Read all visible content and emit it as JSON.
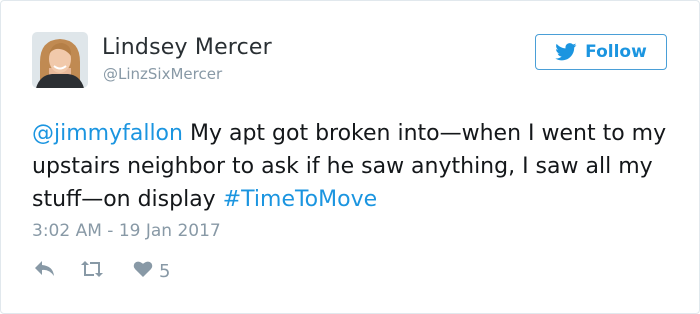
{
  "tweet": {
    "author_name": "Lindsey Mercer",
    "author_handle": "@LinzSixMercer",
    "follow_label": "Follow",
    "text_mention": "@jimmyfallon",
    "text_body": " My apt got broken into—when I went to my upstairs neighbor to ask if he saw anything, I saw all my stuff—on display ",
    "text_hashtag": "#TimeToMove",
    "timestamp": "3:02 AM - 19 Jan 2017",
    "like_count": "5"
  },
  "icons": {
    "reply": "reply-icon",
    "retweet": "retweet-icon",
    "like": "heart-icon",
    "follow": "twitter-bird-icon"
  },
  "colors": {
    "accent": "#1b95e0",
    "muted": "#8899a6",
    "text": "#14171a",
    "border": "#e1e8ed"
  }
}
